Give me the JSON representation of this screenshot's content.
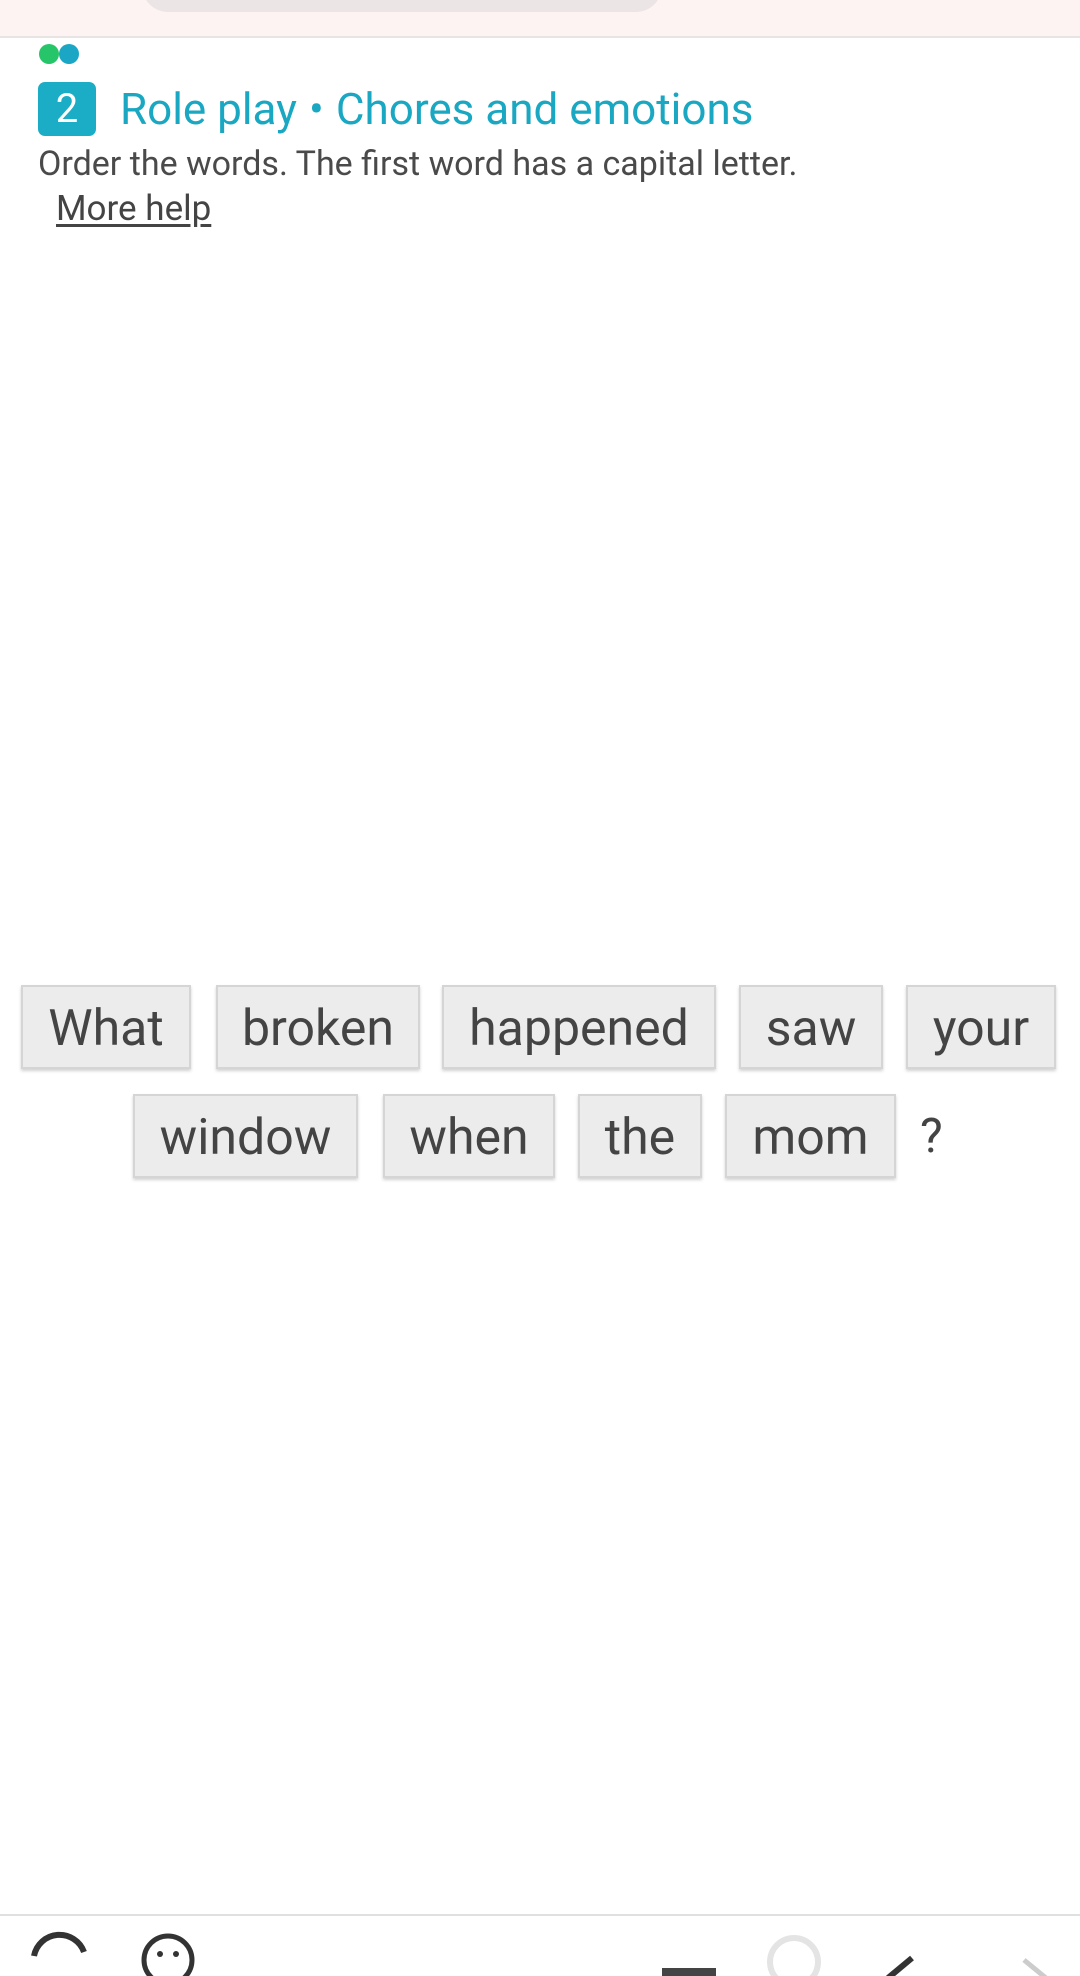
{
  "header": {
    "exercise_number": "2",
    "title_part1": "Role play",
    "separator": "•",
    "title_part2": "Chores and emotions"
  },
  "instructions": "Order the words. The first word has a capital letter.",
  "more_help_label": "More help",
  "progress": {
    "dots": [
      "#27c56a",
      "#1aa6c4"
    ]
  },
  "word_tiles": {
    "row1": [
      "What",
      "broken",
      "happened",
      "saw",
      "your"
    ],
    "row2": [
      "window",
      "when",
      "the",
      "mom"
    ],
    "punctuation": "?"
  },
  "colors": {
    "accent": "#1aa7c2",
    "badge": "#1cadc6",
    "tile_bg": "#ececec",
    "text": "#444444"
  },
  "bottom_bar_icons": [
    "back-icon",
    "emoji-icon",
    "menu-icon",
    "search-icon",
    "check-icon",
    "next-icon"
  ]
}
